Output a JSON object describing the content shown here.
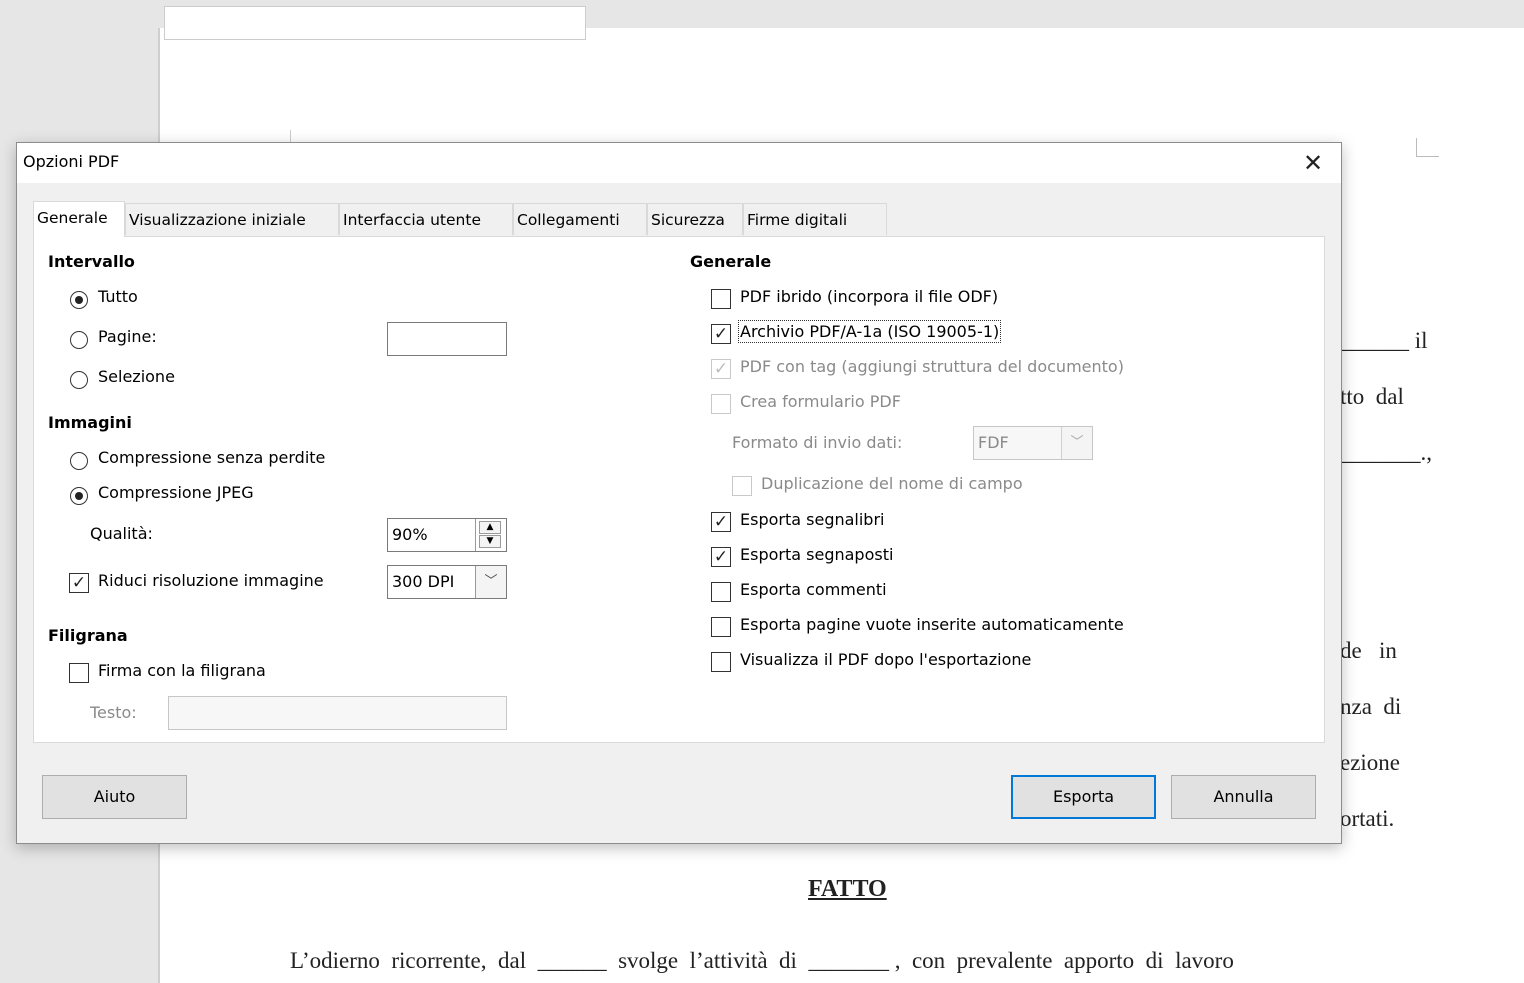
{
  "document": {
    "lines": [
      {
        "text": "______ il"
      },
      {
        "text": "tto  dal"
      },
      {
        "text": "_______.,"
      },
      {
        "text": "de   in"
      },
      {
        "text": "nza  di"
      },
      {
        "text": "ezione"
      },
      {
        "text": "ortati."
      }
    ],
    "heading": "FATTO",
    "body_line": "L’odierno  ricorrente,  dal  ______  svolge  l’attività  di  _______ ,  con  prevalente  apporto  di  lavoro"
  },
  "dialog": {
    "title": "Opzioni PDF",
    "close_glyph": "✕",
    "tabs": [
      "Generale",
      "Visualizzazione iniziale",
      "Interfaccia utente",
      "Collegamenti",
      "Sicurezza",
      "Firme digitali"
    ],
    "left": {
      "range_header": "Intervallo",
      "all_label": "Tutto",
      "pages_label": "Pagine:",
      "pages_value": "",
      "selection_label": "Selezione",
      "images_header": "Immagini",
      "lossless_label": "Compressione senza perdite",
      "jpeg_label": "Compressione JPEG",
      "quality_label": "Qualità:",
      "quality_value": "90%",
      "reduce_label": "Riduci risoluzione immagine",
      "reduce_checked": true,
      "resolution_value": "300 DPI",
      "watermark_header": "Filigrana",
      "watermark_label": "Firma con la filigrana",
      "watermark_checked": false,
      "text_label": "Testo:",
      "text_value": ""
    },
    "right": {
      "header": "Generale",
      "hybrid_label": "PDF ibrido (incorpora il file ODF)",
      "pdfa_label": "Archivio PDF/A-1a (ISO 19005-1)",
      "tagged_label": "PDF con tag (aggiungi struttura del documento)",
      "form_label": "Crea formulario PDF",
      "submit_format_label": "Formato di invio dati:",
      "submit_format_value": "FDF",
      "duplicate_label": "Duplicazione del nome di campo",
      "bookmarks_label": "Esporta segnalibri",
      "placeholders_label": "Esporta segnaposti",
      "comments_label": "Esporta commenti",
      "blank_pages_label": "Esporta pagine vuote inserite automaticamente",
      "view_after_label": "Visualizza il PDF dopo l'esportazione"
    },
    "buttons": {
      "help": "Aiuto",
      "export": "Esporta",
      "cancel": "Annulla"
    },
    "check_glyph": "✓"
  }
}
